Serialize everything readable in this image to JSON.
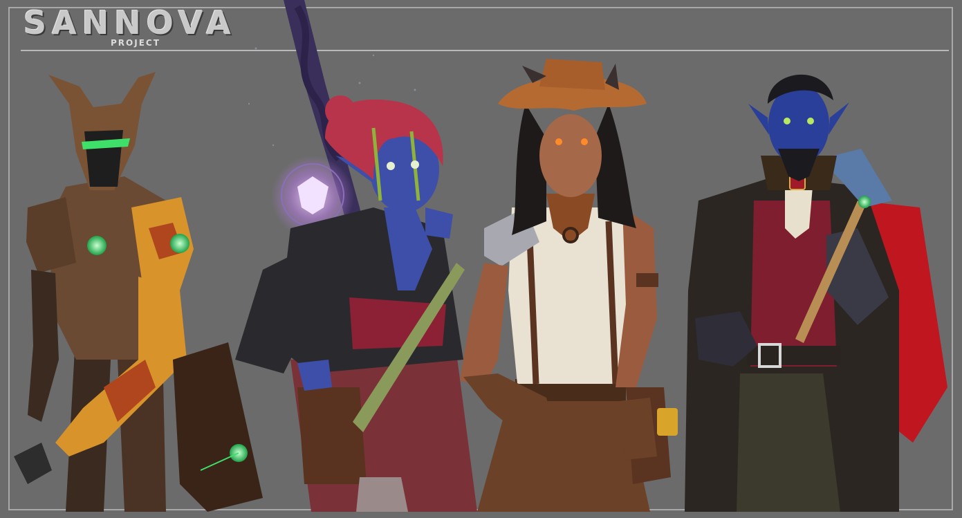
{
  "logo": {
    "title": "SANNOVA",
    "subtitle": "PROJECT"
  },
  "colors": {
    "background": "#6b6b6b",
    "frame": "#a9a9a9",
    "armor_brown": "#6a4a32",
    "armor_orange": "#d8942a",
    "visor_green": "#3fe06a",
    "skin_blue": "#3d4fa8",
    "robe_black": "#2a2a2e",
    "sash_red": "#8c2035",
    "hair_red": "#b8344a",
    "skin_tan": "#9a5b3e",
    "shirt_cream": "#e9e1d2",
    "leather_brown": "#6b4128",
    "hat_orange": "#b56a32",
    "coat_dark": "#2b2622",
    "cape_red": "#c0161f",
    "vest_red": "#7e1e2e"
  },
  "characters": [
    {
      "id": "armored-construct",
      "icon": "armored-warrior-figure"
    },
    {
      "id": "blue-mage",
      "icon": "mage-with-staff-figure"
    },
    {
      "id": "gunslinger",
      "icon": "cowgirl-gunslinger-figure"
    },
    {
      "id": "caped-rogue",
      "icon": "blue-skinned-rogue-figure"
    }
  ]
}
